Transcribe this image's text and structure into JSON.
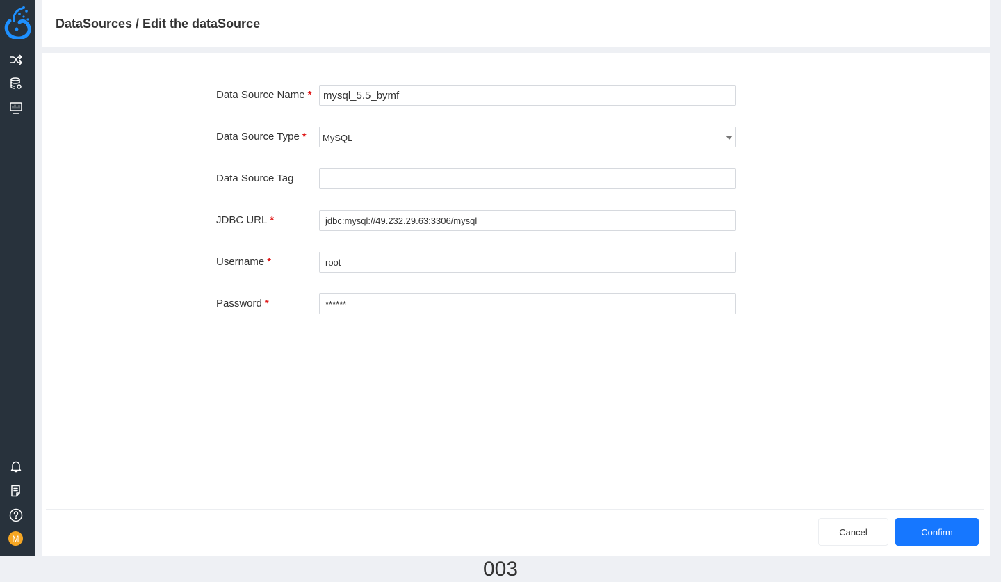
{
  "header": {
    "breadcrumb": "DataSources / Edit the dataSource"
  },
  "sidebar": {
    "items": [
      {
        "icon": "shuffle-icon",
        "label": ""
      },
      {
        "icon": "database-icon",
        "label": ""
      },
      {
        "icon": "monitor-icon",
        "label": ""
      }
    ],
    "bottom_items": [
      {
        "icon": "bell-icon"
      },
      {
        "icon": "document-icon"
      },
      {
        "icon": "help-icon"
      }
    ],
    "avatar_letter": "M",
    "avatar_color": "#f5a623"
  },
  "form": {
    "fields": {
      "name": {
        "label": "Data Source Name",
        "required": "*",
        "value": "mysql_5.5_bymf"
      },
      "type": {
        "label": "Data Source Type",
        "required": "*",
        "value": "MySQL"
      },
      "tag": {
        "label": "Data Source Tag",
        "value": ""
      },
      "jdbc": {
        "label": "JDBC URL",
        "required": "*",
        "value": "jdbc:mysql://49.232.29.63:3306/mysql"
      },
      "username": {
        "label": "Username",
        "required": "*",
        "value": "root"
      },
      "password": {
        "label": "Password",
        "required": "*",
        "value": "******"
      }
    }
  },
  "actions": {
    "cancel_label": "Cancel",
    "confirm_label": "Confirm"
  },
  "colors": {
    "sidebar_bg": "#28323c",
    "accent": "#1677ff",
    "required": "#e01c1c"
  },
  "page_number": "003"
}
